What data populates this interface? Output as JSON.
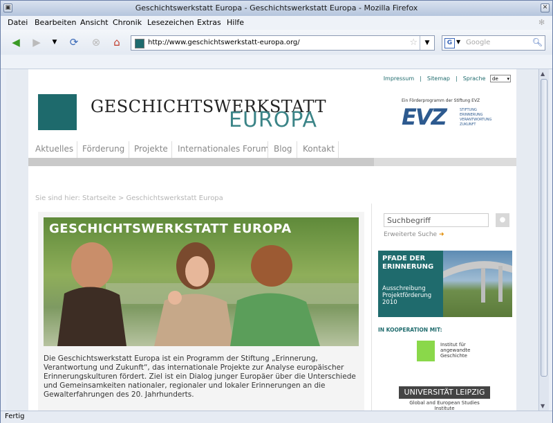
{
  "window": {
    "title": "Geschichtswerkstatt Europa - Geschichtswerkstatt Europa - Mozilla Firefox"
  },
  "menu": [
    "Datei",
    "Bearbeiten",
    "Ansicht",
    "Chronik",
    "Lesezeichen",
    "Extras",
    "Hilfe"
  ],
  "toolbar": {
    "url": "http://www.geschichtswerkstatt-europa.org/",
    "search_placeholder": "Google",
    "search_engine": "G"
  },
  "status": "Fertig",
  "site": {
    "top_links": [
      "Impressum",
      "|",
      "Sitemap",
      "|",
      "Sprache"
    ],
    "language": "de",
    "logo_line1": "GESCHICHTSWERKSTATT",
    "logo_line2": "EUROPA",
    "evz_tagline": "Ein Förderprogramm der Stiftung EVZ",
    "evz_logo": "EVZ",
    "evz_sub1": "STIFTUNG",
    "evz_sub2": "ERINNERUNG",
    "evz_sub3": "VERANTWORTUNG",
    "evz_sub4": "ZUKUNFT",
    "nav": [
      "Aktuelles",
      "Förderung",
      "Projekte",
      "Internationales Forum",
      "Blog",
      "Kontakt"
    ],
    "breadcrumb": "Sie sind hier: Startseite > Geschichtswerkstatt Europa",
    "hero_title": "GESCHICHTSWERKSTATT EUROPA",
    "description": "Die Geschichtswerkstatt Europa ist ein Programm der Stiftung „Erinnerung, Verantwortung und Zukunft“, das internationale Projekte zur Analyse europäischer Erinnerungskulturen fördert. Ziel ist ein Dialog junger Europäer über die Unterschiede und Gemeinsamkeiten nationaler, regionaler und lokaler Erinnerungen an die Gewalterfahrungen des 20. Jahrhunderts.",
    "search_placeholder": "Suchbegriff",
    "advanced_search": "Erweiterte Suche",
    "promo_title_1": "PFADE DER",
    "promo_title_2": "ERINNERUNG",
    "promo_desc_1": "Ausschreibung",
    "promo_desc_2": "Projektförderung",
    "promo_desc_3": "2010",
    "cooperation_label": "IN KOOPERATION MIT:",
    "partner1_line1": "Institut für",
    "partner1_line2": "angewandte",
    "partner1_line3": "Geschichte",
    "partner2_name": "UNIVERSITÄT LEIPZIG",
    "partner2_sub": "Global and European Studies Institute"
  },
  "colors": {
    "brand_teal": "#1e6a6c",
    "evz_blue": "#2d5a8f"
  }
}
